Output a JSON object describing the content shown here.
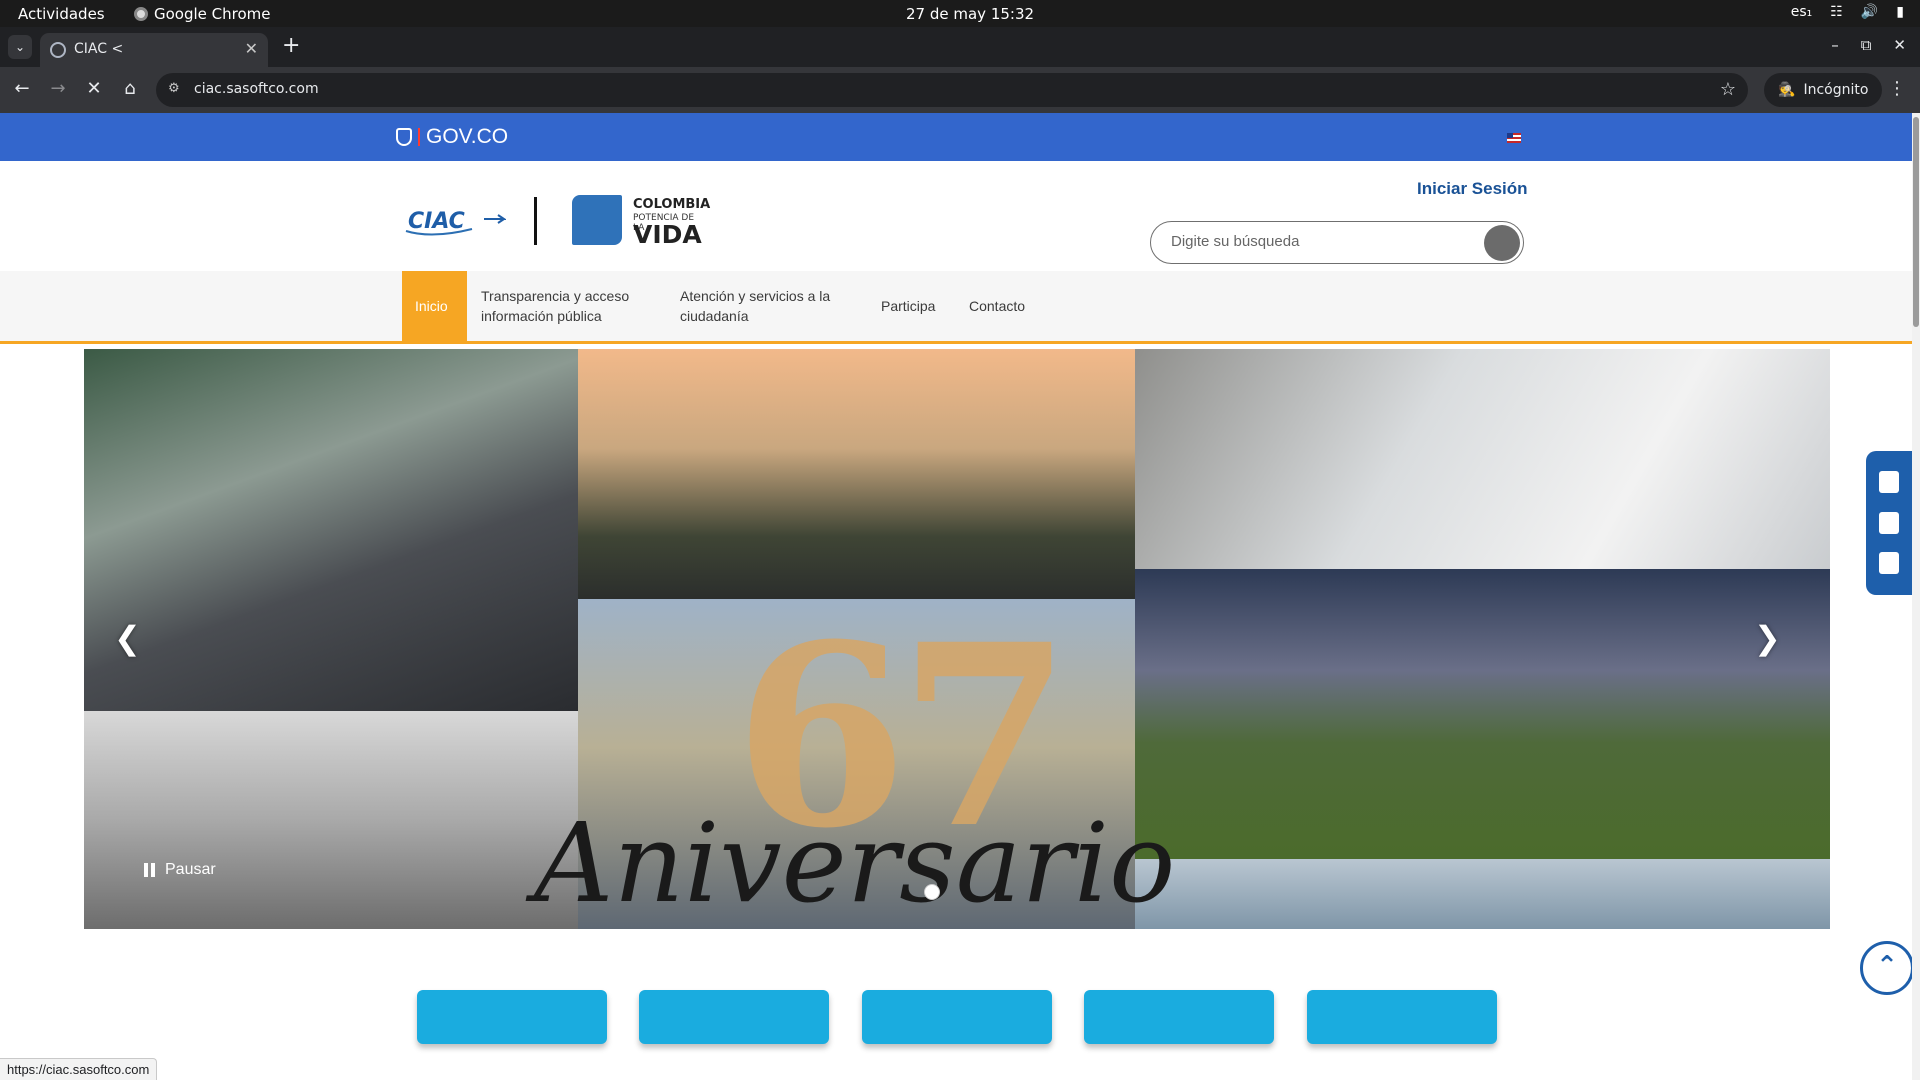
{
  "os": {
    "activities": "Actividades",
    "app_name": "Google Chrome",
    "clock": "27 de may  15:32",
    "keyboard_layout": "es₁"
  },
  "browser": {
    "tab_title": "CIAC <",
    "url": "ciac.sasoftco.com",
    "incognito_label": "Incógnito",
    "status_url": "https://ciac.sasoftco.com"
  },
  "gov_bar": {
    "logo_text": "GOV.CO"
  },
  "header": {
    "ciac_logo_text": "CIAC",
    "colombia_line1": "COLOMBIA",
    "colombia_line2": "POTENCIA DE LA",
    "colombia_line3": "VIDA",
    "login_label": "Iniciar Sesión",
    "search_placeholder": "Digite su búsqueda"
  },
  "nav": {
    "items": [
      {
        "label": "Inicio",
        "active": true
      },
      {
        "label": "Transparencia y acceso información pública",
        "active": false
      },
      {
        "label": "Atención y servicios a la ciudadanía",
        "active": false
      },
      {
        "label": "Participa",
        "active": false
      },
      {
        "label": "Contacto",
        "active": false
      }
    ]
  },
  "carousel": {
    "anniversary_number": "67",
    "anniversary_word": "Aniversario",
    "pause_label": "Pausar",
    "slide_count": 1,
    "active_slide": 1
  },
  "colors": {
    "gov_blue": "#3366cc",
    "nav_accent": "#f6a623",
    "quick_button": "#1aacdf",
    "widget_blue": "#1e5fab",
    "login_link": "#1a5296"
  }
}
